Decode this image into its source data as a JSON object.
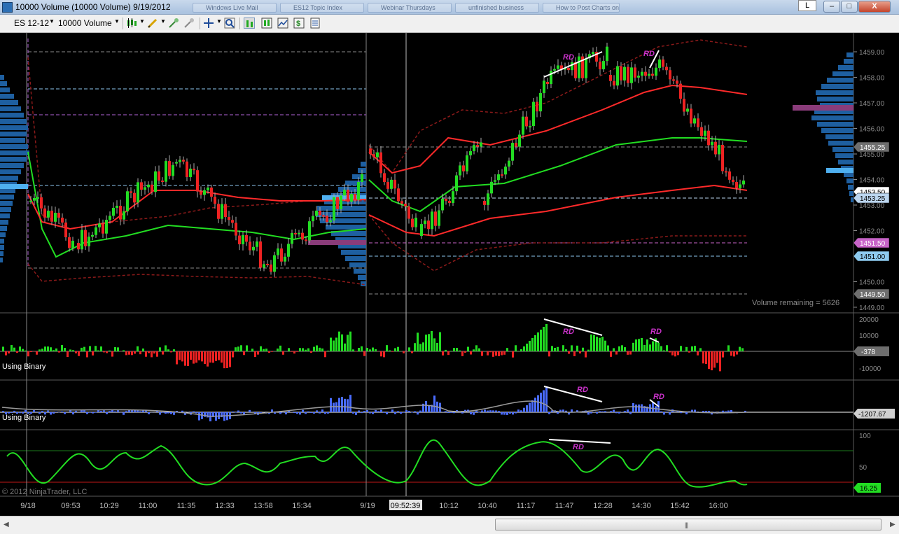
{
  "window": {
    "title": "10000 Volume (10000 Volume)  9/19/2012",
    "user_button": "L",
    "background_tabs": [
      "Windows Live Mail",
      "ES12 Topic Index",
      "Webinar Thursdays",
      "unfinished business",
      "How to Post Charts on Topic"
    ]
  },
  "toolbar": {
    "instrument": "ES 12-12",
    "period": "10000 Volume"
  },
  "chart": {
    "price_axis": {
      "ticks": [
        "1459.00",
        "1458.00",
        "1457.00",
        "1456.00",
        "1455.00",
        "1454.00",
        "1453.00",
        "1452.00",
        "1451.00",
        "1450.00",
        "1449.00"
      ],
      "markers": [
        {
          "label": "1455.25",
          "color": "#6e6e6e"
        },
        {
          "label": "1453.50",
          "color": "#ffffff"
        },
        {
          "label": "1453.25",
          "color": "#bcd6ef"
        },
        {
          "label": "1451.50",
          "color": "#c864c8"
        },
        {
          "label": "1451.00",
          "color": "#8ecbf0"
        },
        {
          "label": "1449.50",
          "color": "#6e6e6e"
        }
      ]
    },
    "volume_remaining": "Volume remaining = 5626",
    "panel2": {
      "label": "Using Binary",
      "ticks": [
        "20000",
        "10000",
        "-10000"
      ],
      "value": "-378"
    },
    "panel3": {
      "label": "Using Binary",
      "value": "-1207.67"
    },
    "panel4": {
      "ticks": [
        "100",
        "50"
      ],
      "value": "16.25"
    },
    "time_axis": {
      "labels": [
        "9/18",
        "09:53",
        "10:29",
        "11:00",
        "11:35",
        "12:33",
        "13:58",
        "15:34",
        "9/19",
        "10:12",
        "10:40",
        "11:17",
        "11:47",
        "12:28",
        "14:30",
        "15:42",
        "16:00"
      ],
      "cursor_time": "09:52:39"
    },
    "annotation": "RD",
    "copyright": "© 2012 NinjaTrader, LLC",
    "colors": {
      "up": "#22dd22",
      "down": "#ee2222",
      "ma_red": "#ff2a2a",
      "ma_green": "#22dd22",
      "band": "#8b1a1a",
      "blue": "#4a6cff",
      "profile": "#1e5fa0"
    }
  }
}
